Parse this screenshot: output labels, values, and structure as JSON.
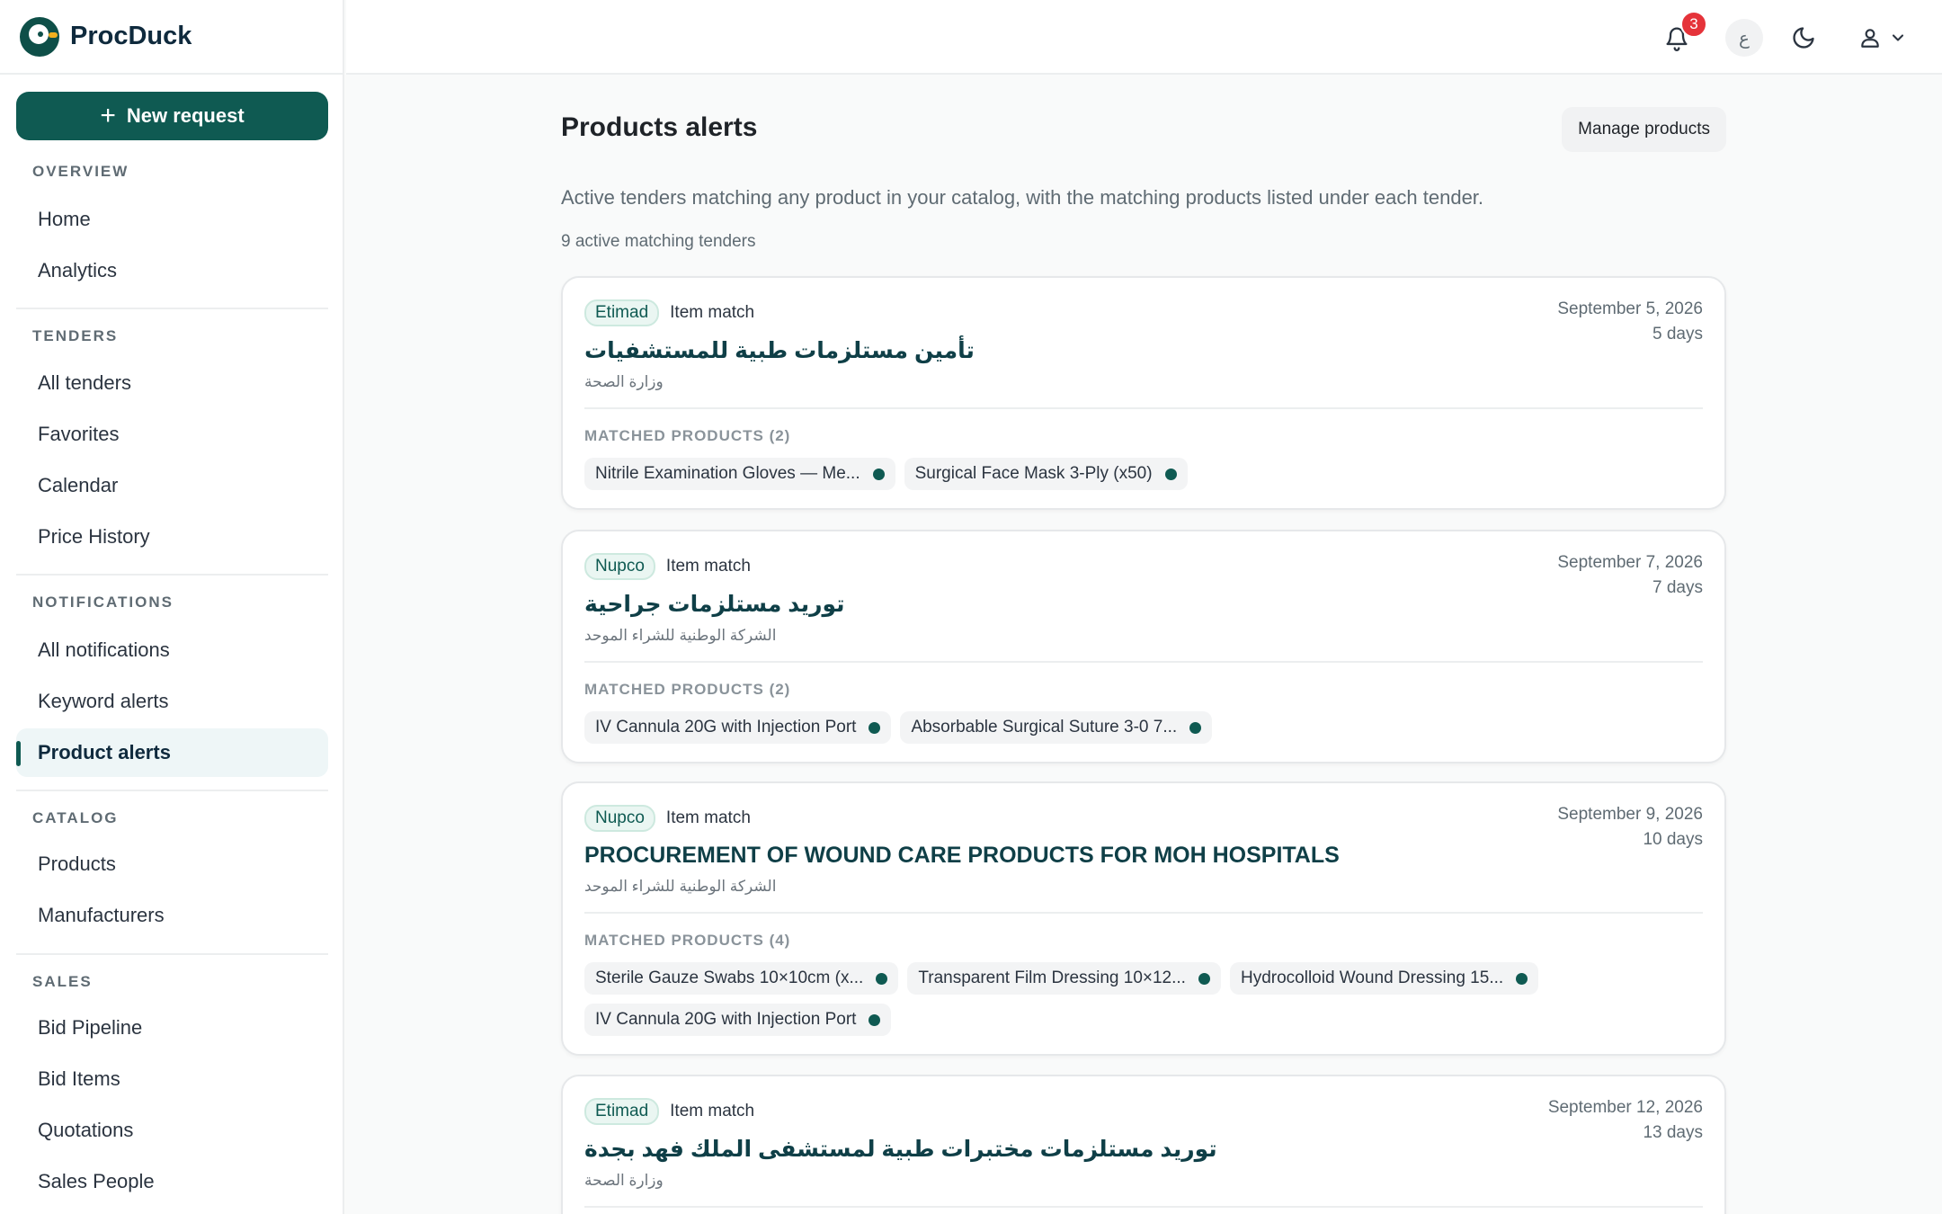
{
  "app": {
    "name": "ProcDuck"
  },
  "sidebar": {
    "new_request_label": "New request",
    "sections": [
      {
        "title": "OVERVIEW",
        "items": [
          "Home",
          "Analytics"
        ]
      },
      {
        "title": "TENDERS",
        "items": [
          "All tenders",
          "Favorites",
          "Calendar",
          "Price History"
        ]
      },
      {
        "title": "NOTIFICATIONS",
        "items": [
          "All notifications",
          "Keyword alerts",
          "Product alerts"
        ]
      },
      {
        "title": "CATALOG",
        "items": [
          "Products",
          "Manufacturers"
        ]
      },
      {
        "title": "SALES",
        "items": [
          "Bid Pipeline",
          "Bid Items",
          "Quotations",
          "Sales People"
        ]
      }
    ],
    "active_item": "Product alerts"
  },
  "topbar": {
    "notification_count": "3",
    "language_label": "ع"
  },
  "page": {
    "title": "Products alerts",
    "manage_label": "Manage products",
    "subtitle": "Active tenders matching any product in your catalog, with the matching products listed under each tender.",
    "count_label": "9 active matching tenders"
  },
  "tenders": [
    {
      "source": "Etimad",
      "match_type": "Item match",
      "title": "تأمين مستلزمات طبية للمستشفيات",
      "org": "وزارة الصحة",
      "date": "September 5, 2026",
      "days": "5 days",
      "matched_label": "MATCHED PRODUCTS (2)",
      "products": [
        "Nitrile Examination Gloves — Me...",
        "Surgical Face Mask 3-Ply (x50)"
      ]
    },
    {
      "source": "Nupco",
      "match_type": "Item match",
      "title": "توريد مستلزمات جراحية",
      "org": "الشركة الوطنية للشراء الموحد",
      "date": "September 7, 2026",
      "days": "7 days",
      "matched_label": "MATCHED PRODUCTS (2)",
      "products": [
        "IV Cannula 20G with Injection Port",
        "Absorbable Surgical Suture 3-0 7..."
      ]
    },
    {
      "source": "Nupco",
      "match_type": "Item match",
      "title": "PROCUREMENT OF WOUND CARE PRODUCTS FOR MOH HOSPITALS",
      "org": "الشركة الوطنية للشراء الموحد",
      "date": "September 9, 2026",
      "days": "10 days",
      "matched_label": "MATCHED PRODUCTS (4)",
      "products": [
        "Sterile Gauze Swabs 10×10cm (x...",
        "Transparent Film Dressing 10×12...",
        "Hydrocolloid Wound Dressing 15...",
        "IV Cannula 20G with Injection Port"
      ]
    },
    {
      "source": "Etimad",
      "match_type": "Item match",
      "title": "توريد مستلزمات مختبرات طبية لمستشفى الملك فهد بجدة",
      "org": "وزارة الصحة",
      "date": "September 12, 2026",
      "days": "13 days"
    }
  ]
}
